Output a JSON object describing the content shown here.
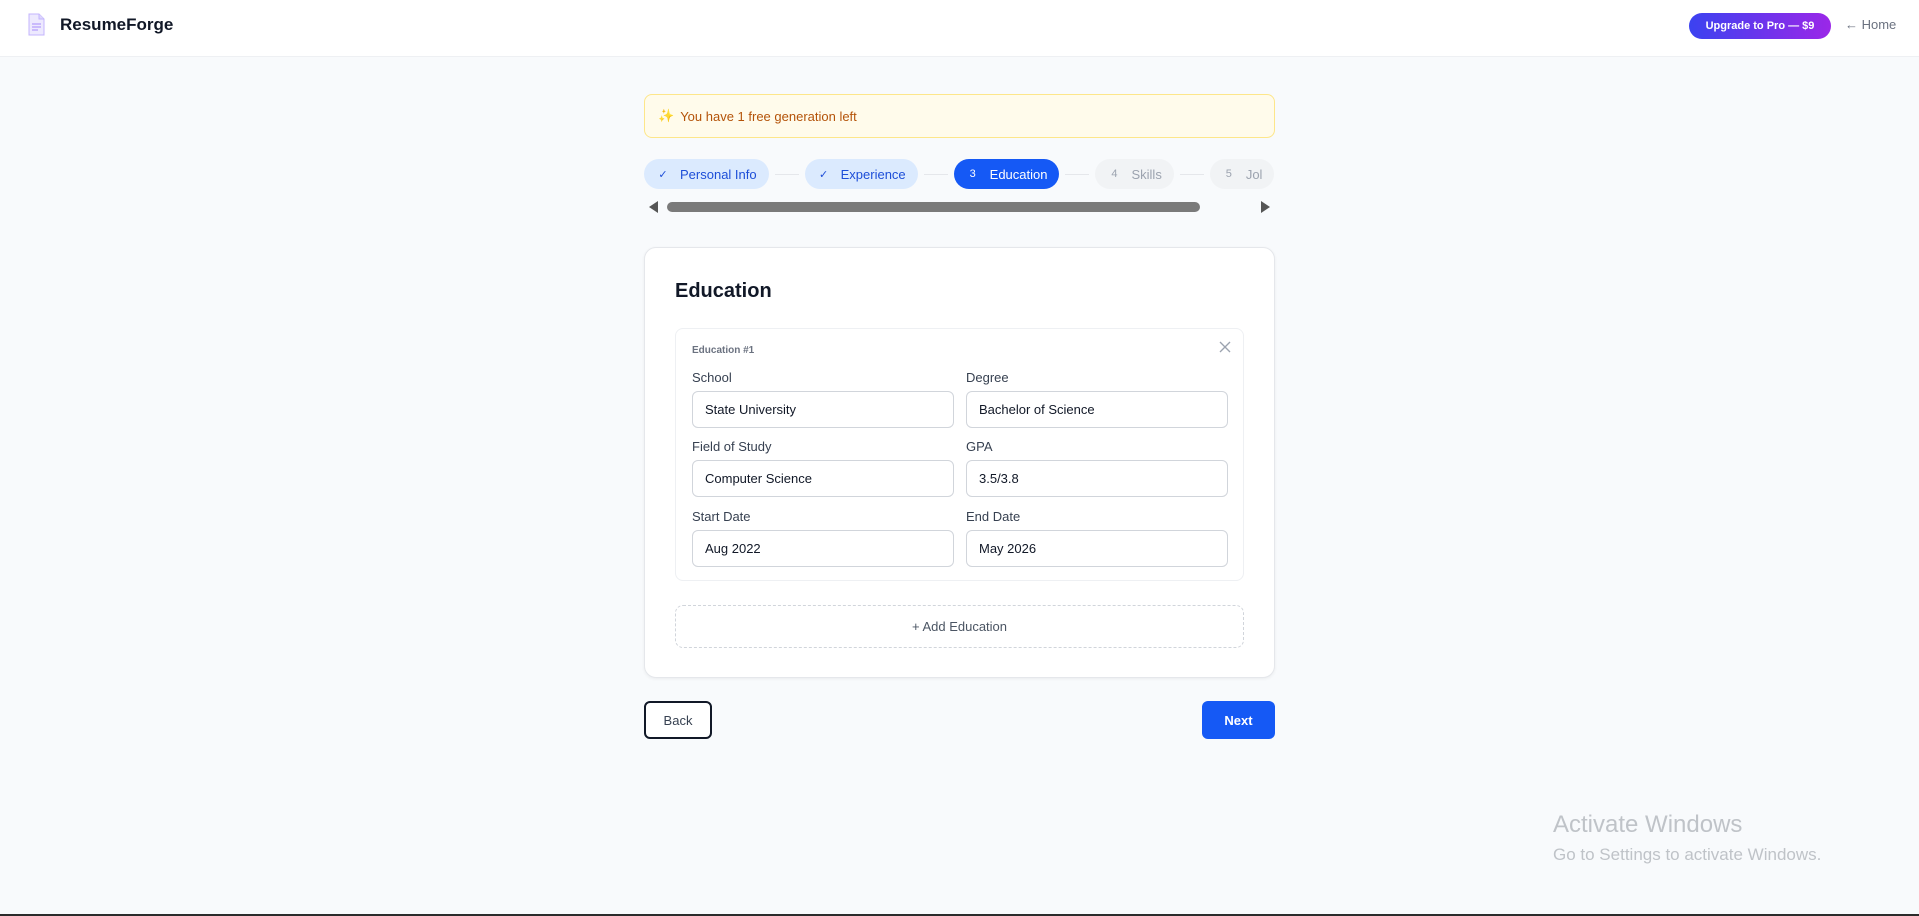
{
  "header": {
    "brand_name": "ResumeForge",
    "brand_icon": "document-icon",
    "upgrade_label": "Upgrade to Pro — $9",
    "home_label": "← Home"
  },
  "banner": {
    "icon": "sparkles-icon",
    "text": "You have 1 free generation left"
  },
  "steps": [
    {
      "marker": "✓",
      "label": "Personal Info",
      "state": "done"
    },
    {
      "marker": "✓",
      "label": "Experience",
      "state": "done"
    },
    {
      "marker": "3",
      "label": "Education",
      "state": "active"
    },
    {
      "marker": "4",
      "label": "Skills",
      "state": "future"
    },
    {
      "marker": "5",
      "label": "Jol",
      "state": "future"
    }
  ],
  "card": {
    "title": "Education",
    "entry": {
      "label": "Education #1",
      "school_label": "School",
      "school_value": "State University",
      "degree_label": "Degree",
      "degree_value": "Bachelor of Science",
      "field_label": "Field of Study",
      "field_value": "Computer Science",
      "gpa_label": "GPA",
      "gpa_value": "3.5/3.8",
      "start_label": "Start Date",
      "start_value": "Aug 2022",
      "end_label": "End Date",
      "end_value": "May 2026"
    },
    "add_label": "+ Add Education"
  },
  "nav": {
    "back_label": "Back",
    "next_label": "Next"
  },
  "watermark": {
    "title": "Activate Windows",
    "subtitle": "Go to Settings to activate Windows."
  },
  "colors": {
    "primary": "#1559f5",
    "banner_bg": "#fffbeb",
    "banner_text": "#b45309",
    "step_done_bg": "#dbeafe"
  }
}
